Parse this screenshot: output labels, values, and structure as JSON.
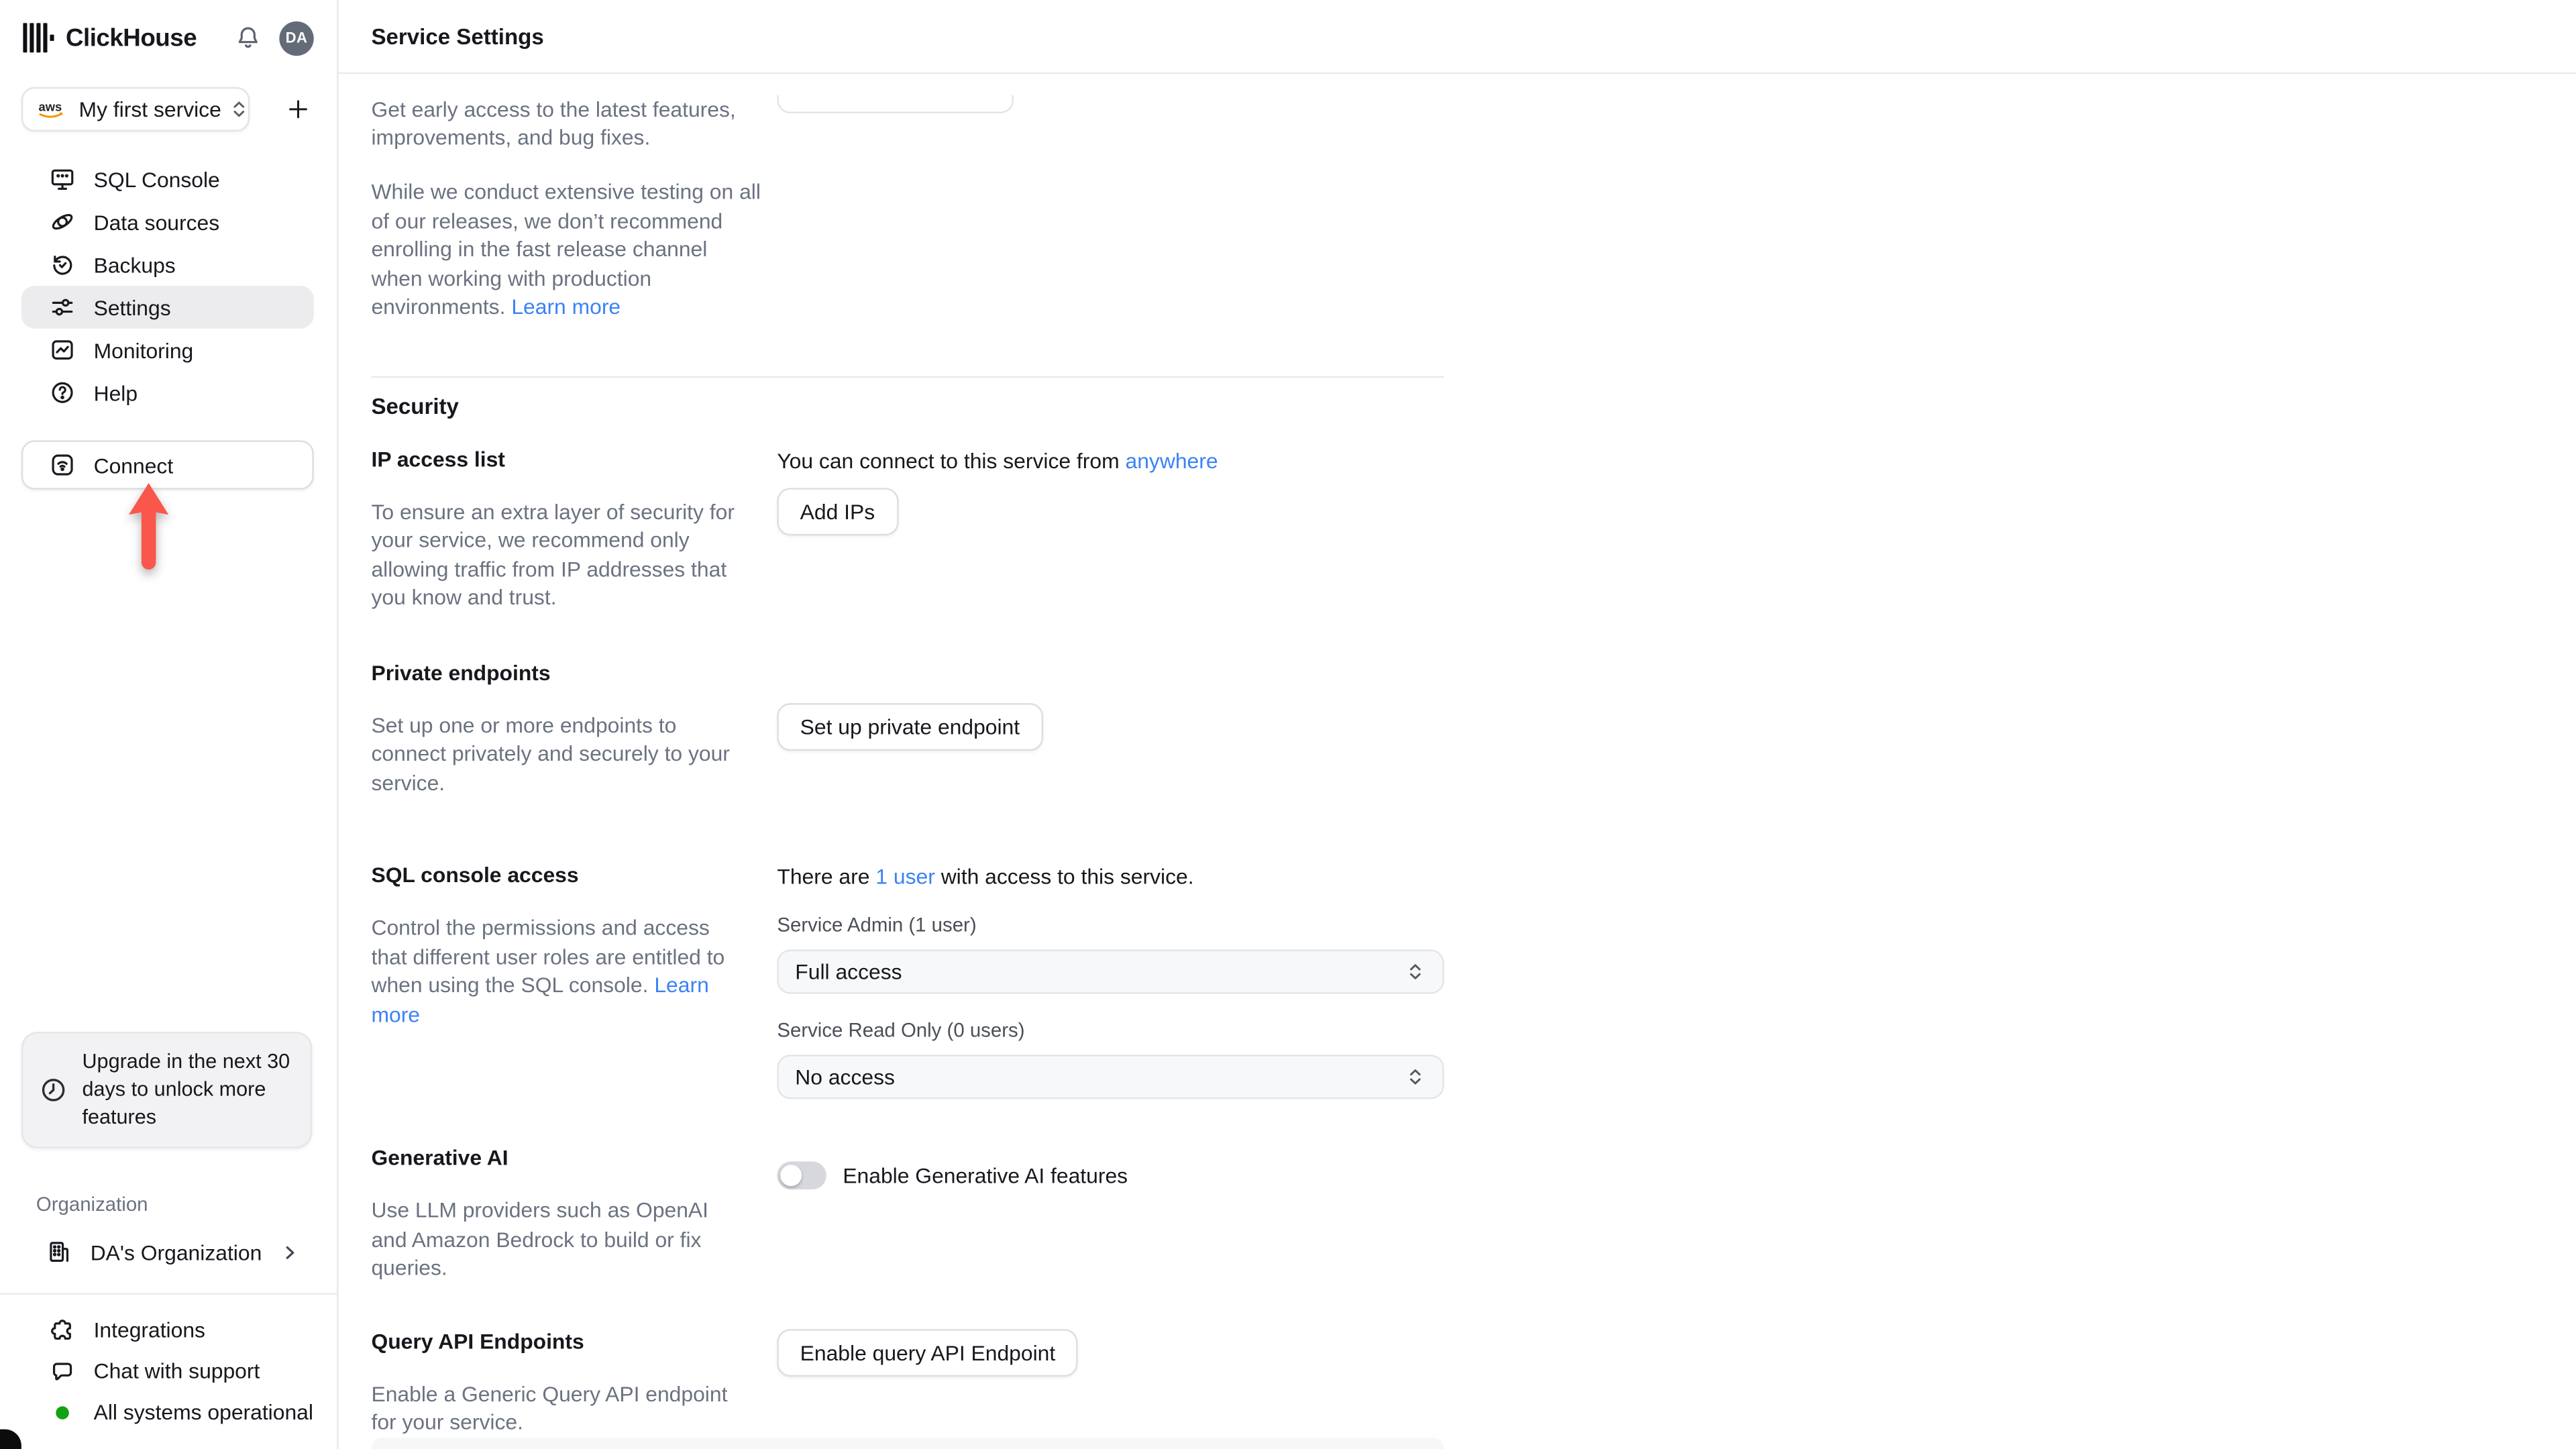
{
  "brand": {
    "name": "ClickHouse"
  },
  "topbar": {
    "avatar_initials": "DA"
  },
  "sidebar": {
    "service_selector": {
      "provider": "aws",
      "label": "My first service"
    },
    "nav": [
      {
        "label": "SQL Console"
      },
      {
        "label": "Data sources"
      },
      {
        "label": "Backups"
      },
      {
        "label": "Settings"
      },
      {
        "label": "Monitoring"
      },
      {
        "label": "Help"
      }
    ],
    "connect_label": "Connect",
    "upgrade_notice": "Upgrade in the next 30 days to unlock more features",
    "organization": {
      "section_label": "Organization",
      "name": "DA's Organization"
    },
    "footer": [
      {
        "label": "Integrations"
      },
      {
        "label": "Chat with support"
      },
      {
        "label": "All systems operational"
      }
    ]
  },
  "header": {
    "title": "Service Settings"
  },
  "content": {
    "fast_release": {
      "desc1": "Get early access to the latest features, improvements, and bug fixes.",
      "desc2": "While we conduct extensive testing on all of our releases, we don’t recommend enrolling in the fast release channel when working with production environments.",
      "learn_more": "Learn more"
    },
    "security": {
      "heading": "Security",
      "ip_access": {
        "title": "IP access list",
        "desc": "To ensure an extra layer of security for your service, we recommend only allowing traffic from IP addresses that you know and trust.",
        "status_pre": "You can connect to this service from",
        "status_link": "anywhere",
        "button": "Add IPs"
      },
      "private_endpoints": {
        "title": "Private endpoints",
        "desc": "Set up one or more endpoints to connect privately and securely to your service.",
        "button": "Set up private endpoint"
      },
      "sql": {
        "title": "SQL console access",
        "desc": "Control the permissions and access that different user roles are entitled to when using the SQL console.",
        "learn_more": "Learn more",
        "status_pre": "There are",
        "status_link": "1 user",
        "status_post": "with access to this service.",
        "admin_label": "Service Admin (1 user)",
        "admin_value": "Full access",
        "readonly_label": "Service Read Only (0 users)",
        "readonly_value": "No access"
      },
      "generative_ai": {
        "title": "Generative AI",
        "desc": "Use LLM providers such as OpenAI and Amazon Bedrock to build or fix queries.",
        "toggle_label": "Enable Generative AI features"
      },
      "query_api": {
        "title": "Query API Endpoints",
        "desc": "Enable a Generic Query API endpoint for your service.",
        "button": "Enable query API Endpoint"
      }
    }
  },
  "colors": {
    "link_blue": "#3b82f6",
    "arrow_red": "#f9574b",
    "status_green": "#12a312",
    "avatar_bg": "#646b78",
    "aws_orange": "#f79400",
    "active_nav_bg": "#ececef"
  }
}
